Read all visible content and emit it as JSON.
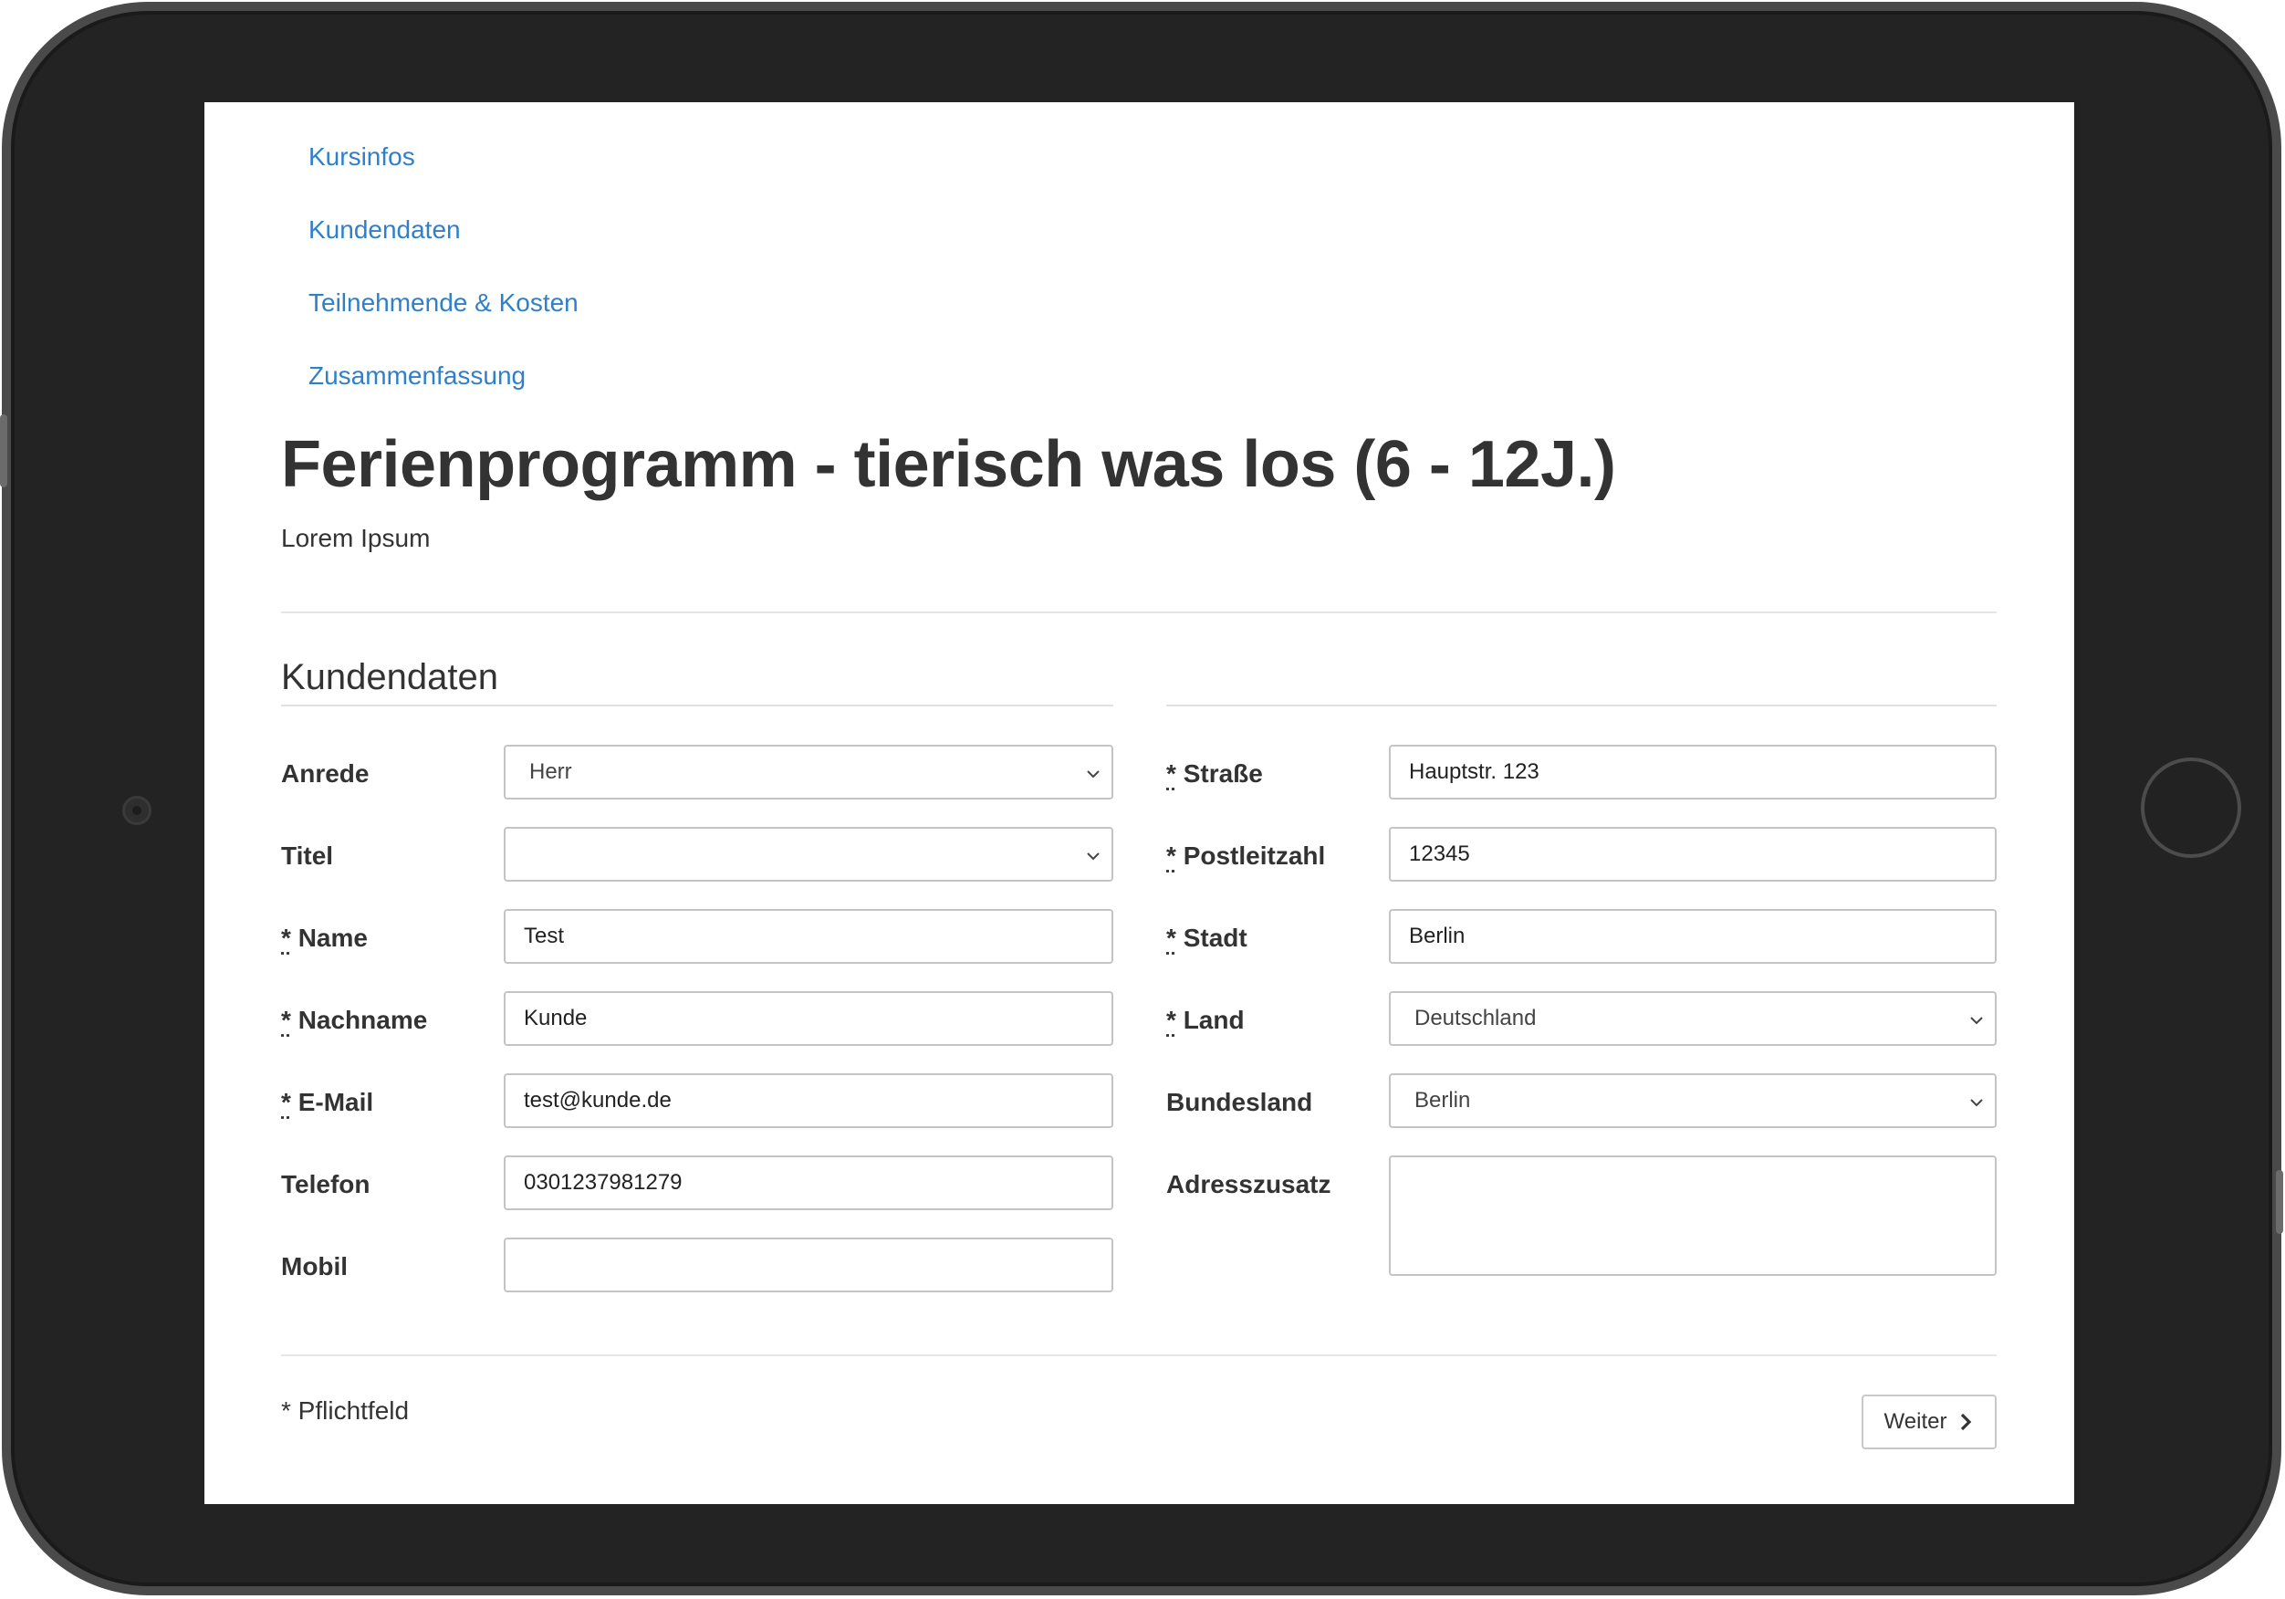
{
  "steps": [
    "Kursinfos",
    "Kundendaten",
    "Teilnehmende & Kosten",
    "Zusammenfassung"
  ],
  "page": {
    "title": "Ferienprogramm - tierisch was los (6 - 12J.)",
    "subtitle": "Lorem Ipsum",
    "section_title": "Kundendaten"
  },
  "left": {
    "anrede": {
      "label": "Anrede",
      "value": "Herr"
    },
    "titel": {
      "label": "Titel",
      "value": ""
    },
    "name": {
      "label": "Name",
      "value": "Test"
    },
    "nachname": {
      "label": "Nachname",
      "value": "Kunde"
    },
    "email": {
      "label": "E-Mail",
      "value": "test@kunde.de"
    },
    "telefon": {
      "label": "Telefon",
      "value": "0301237981279"
    },
    "mobil": {
      "label": "Mobil",
      "value": ""
    }
  },
  "right": {
    "strasse": {
      "label": "Straße",
      "value": "Hauptstr. 123"
    },
    "plz": {
      "label": "Postleitzahl",
      "value": "12345"
    },
    "stadt": {
      "label": "Stadt",
      "value": "Berlin"
    },
    "land": {
      "label": "Land",
      "value": "Deutschland"
    },
    "bundesland": {
      "label": "Bundesland",
      "value": "Berlin"
    },
    "adresszusatz": {
      "label": "Adresszusatz",
      "value": ""
    }
  },
  "required_marker": "*",
  "footer": {
    "note": "* Pflichtfeld",
    "next_label": "Weiter"
  },
  "colors": {
    "link": "#2f80c8",
    "text": "#333333",
    "border": "#c4c4c4"
  },
  "icons": {
    "select": "chevron-down-icon",
    "next": "chevron-right-icon"
  }
}
